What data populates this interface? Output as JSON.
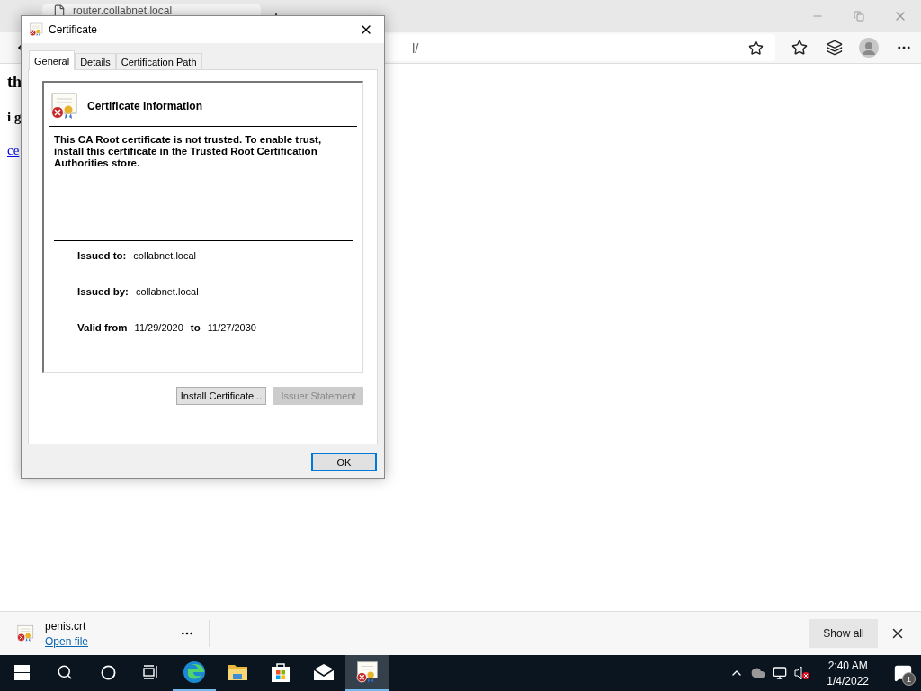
{
  "browser": {
    "tab": {
      "title": "router.collabnet.local"
    },
    "address": {
      "value": "l/"
    }
  },
  "page": {
    "lines": [
      {
        "text": "th",
        "kind": "heading"
      },
      {
        "text": "i g",
        "kind": "bold"
      },
      {
        "text": "ce",
        "kind": "link"
      }
    ]
  },
  "dialog": {
    "title": "Certificate",
    "tabs": [
      {
        "label": "General",
        "selected": true
      },
      {
        "label": "Details",
        "selected": false
      },
      {
        "label": "Certification Path",
        "selected": false
      }
    ],
    "info_title": "Certificate Information",
    "message": "This CA Root certificate is not trusted. To enable trust, install this certificate in the Trusted Root Certification Authorities store.",
    "fields": [
      {
        "label": "Issued to:",
        "value": "collabnet.local"
      },
      {
        "label": "Issued by:",
        "value": "collabnet.local"
      }
    ],
    "validity": {
      "label": "Valid from",
      "from": "11/29/2020",
      "to_label": "to",
      "to": "11/27/2030"
    },
    "buttons": [
      {
        "label": "Install Certificate...",
        "disabled": false
      },
      {
        "label": "Issuer Statement",
        "disabled": true
      }
    ],
    "ok": "OK"
  },
  "download": {
    "file": "penis.crt",
    "action": "Open file",
    "show_all": "Show all"
  },
  "taskbar": {
    "apps": [
      {
        "kind": "edge",
        "running": true,
        "active": false
      },
      {
        "kind": "explorer",
        "running": false,
        "active": false
      },
      {
        "kind": "store",
        "running": false,
        "active": false
      },
      {
        "kind": "mail",
        "running": false,
        "active": false
      },
      {
        "kind": "certificate",
        "running": true,
        "active": true
      }
    ],
    "time": "2:40 AM",
    "date": "1/4/2022",
    "notifications": "1"
  }
}
